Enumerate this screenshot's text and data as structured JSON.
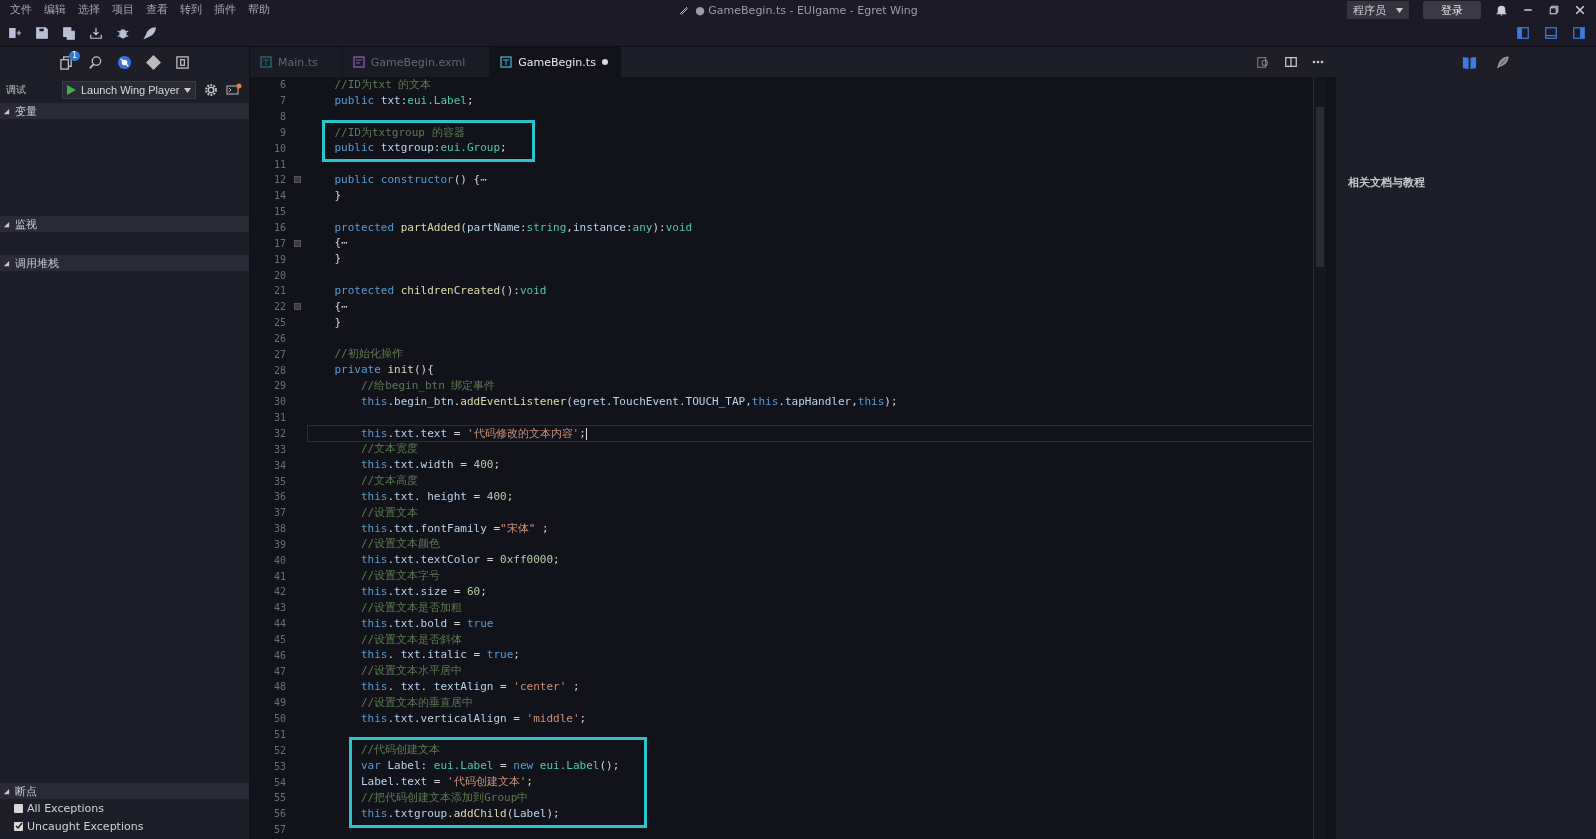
{
  "menu": [
    "文件",
    "编辑",
    "选择",
    "项目",
    "查看",
    "转到",
    "插件",
    "帮助"
  ],
  "window": {
    "title": "● GameBegin.ts - EUIgame - Egret Wing"
  },
  "account": {
    "role": "程序员",
    "login": "登录"
  },
  "activity": {
    "badge": "1"
  },
  "debug": {
    "label": "调试",
    "launch_config": "Launch Wing Player"
  },
  "sections": [
    {
      "title": "变量",
      "expanded": true
    },
    {
      "title": "监视",
      "expanded": true
    },
    {
      "title": "调用堆栈",
      "expanded": true
    }
  ],
  "breakpoints": {
    "title": "断点",
    "expanded": true,
    "items": [
      {
        "label": "All Exceptions",
        "checked": false
      },
      {
        "label": "Uncaught Exceptions",
        "checked": true
      }
    ]
  },
  "tabs": [
    {
      "label": "Main.ts",
      "kind": "ts",
      "selected": false,
      "modified": false
    },
    {
      "label": "GameBegin.exml",
      "kind": "exml",
      "selected": false,
      "modified": false
    },
    {
      "label": "GameBegin.ts",
      "kind": "ts",
      "selected": true,
      "modified": true
    }
  ],
  "editor": {
    "blocks": [
      {
        "boxed": false,
        "lines": [
          {
            "number": "6",
            "folded": false,
            "current": false,
            "tokens": [
              {
                "kind": "comment",
                "text": "    //ID为txt 的文本"
              }
            ]
          },
          {
            "number": "7",
            "folded": false,
            "current": false,
            "tokens": [
              {
                "kind": "keyword",
                "text": "    public "
              },
              {
                "kind": "var",
                "text": "txt"
              },
              {
                "kind": "punct",
                "text": ":"
              },
              {
                "kind": "type",
                "text": "eui.Label"
              },
              {
                "kind": "punct",
                "text": ";"
              }
            ]
          },
          {
            "number": "8",
            "folded": false,
            "current": false
          }
        ]
      },
      {
        "boxed": true,
        "lines": [
          {
            "number": "9",
            "folded": false,
            "current": false,
            "tokens": [
              {
                "kind": "comment",
                "text": "    //ID为txtgroup 的容器"
              }
            ]
          },
          {
            "number": "10",
            "folded": false,
            "current": false,
            "tokens": [
              {
                "kind": "keyword",
                "text": "    public "
              },
              {
                "kind": "var",
                "text": "txtgroup"
              },
              {
                "kind": "punct",
                "text": ":"
              },
              {
                "kind": "type",
                "text": "eui.Group"
              },
              {
                "kind": "punct",
                "text": ";"
              }
            ]
          }
        ]
      },
      {
        "boxed": false,
        "lines": [
          {
            "number": "11",
            "folded": false,
            "current": false
          },
          {
            "number": "12",
            "folded": true,
            "current": false,
            "tokens": [
              {
                "kind": "keyword",
                "text": "    public constructor"
              },
              {
                "kind": "punct",
                "text": "() {⋯"
              }
            ]
          },
          {
            "number": "14",
            "folded": false,
            "current": false,
            "tokens": [
              {
                "kind": "punct",
                "text": "    }"
              }
            ]
          },
          {
            "number": "15",
            "folded": false,
            "current": false
          },
          {
            "number": "16",
            "folded": false,
            "current": false,
            "tokens": [
              {
                "kind": "keyword",
                "text": "    protected "
              },
              {
                "kind": "func",
                "text": "partAdded"
              },
              {
                "kind": "punct",
                "text": "("
              },
              {
                "kind": "var",
                "text": "partName"
              },
              {
                "kind": "punct",
                "text": ":"
              },
              {
                "kind": "type",
                "text": "string"
              },
              {
                "kind": "punct",
                "text": ","
              },
              {
                "kind": "var",
                "text": "instance"
              },
              {
                "kind": "punct",
                "text": ":"
              },
              {
                "kind": "type",
                "text": "any"
              },
              {
                "kind": "punct",
                "text": "):"
              },
              {
                "kind": "type",
                "text": "void"
              }
            ]
          },
          {
            "number": "17",
            "folded": true,
            "current": false,
            "tokens": [
              {
                "kind": "punct",
                "text": "    {⋯"
              }
            ]
          },
          {
            "number": "19",
            "folded": false,
            "current": false,
            "tokens": [
              {
                "kind": "punct",
                "text": "    }"
              }
            ]
          },
          {
            "number": "20",
            "folded": false,
            "current": false
          },
          {
            "number": "21",
            "folded": false,
            "current": false,
            "tokens": [
              {
                "kind": "keyword",
                "text": "    protected "
              },
              {
                "kind": "func",
                "text": "childrenCreated"
              },
              {
                "kind": "punct",
                "text": "():"
              },
              {
                "kind": "type",
                "text": "void"
              }
            ]
          },
          {
            "number": "22",
            "folded": true,
            "current": false,
            "tokens": [
              {
                "kind": "punct",
                "text": "    {⋯"
              }
            ]
          },
          {
            "number": "25",
            "folded": false,
            "current": false,
            "tokens": [
              {
                "kind": "punct",
                "text": "    }"
              }
            ]
          },
          {
            "number": "26",
            "folded": false,
            "current": false
          },
          {
            "number": "27",
            "folded": false,
            "current": false,
            "tokens": [
              {
                "kind": "comment",
                "text": "    //初始化操作"
              }
            ]
          },
          {
            "number": "28",
            "folded": false,
            "current": false,
            "tokens": [
              {
                "kind": "keyword",
                "text": "    private "
              },
              {
                "kind": "func",
                "text": "init"
              },
              {
                "kind": "punct",
                "text": "(){"
              }
            ]
          },
          {
            "number": "29",
            "folded": false,
            "current": false,
            "tokens": [
              {
                "kind": "comment",
                "text": "        //给begin_btn 绑定事件"
              }
            ]
          },
          {
            "number": "30",
            "folded": false,
            "current": false,
            "tokens": [
              {
                "kind": "keyword",
                "text": "        this"
              },
              {
                "kind": "punct",
                "text": "."
              },
              {
                "kind": "var",
                "text": "begin_btn"
              },
              {
                "kind": "punct",
                "text": "."
              },
              {
                "kind": "func",
                "text": "addEventListener"
              },
              {
                "kind": "punct",
                "text": "("
              },
              {
                "kind": "var",
                "text": "egret"
              },
              {
                "kind": "punct",
                "text": "."
              },
              {
                "kind": "var",
                "text": "TouchEvent"
              },
              {
                "kind": "punct",
                "text": "."
              },
              {
                "kind": "var",
                "text": "TOUCH_TAP"
              },
              {
                "kind": "punct",
                "text": ","
              },
              {
                "kind": "keyword",
                "text": "this"
              },
              {
                "kind": "punct",
                "text": "."
              },
              {
                "kind": "var",
                "text": "tapHandler"
              },
              {
                "kind": "punct",
                "text": ","
              },
              {
                "kind": "keyword",
                "text": "this"
              },
              {
                "kind": "punct",
                "text": ");"
              }
            ]
          },
          {
            "number": "31",
            "folded": false,
            "current": false
          },
          {
            "number": "32",
            "folded": false,
            "current": true,
            "tokens": [
              {
                "kind": "keyword",
                "text": "        this"
              },
              {
                "kind": "punct",
                "text": "."
              },
              {
                "kind": "var",
                "text": "txt"
              },
              {
                "kind": "punct",
                "text": "."
              },
              {
                "kind": "var",
                "text": "text"
              },
              {
                "kind": "punct",
                "text": " = "
              },
              {
                "kind": "string",
                "text": "'代码修改的文本内容'"
              },
              {
                "kind": "punct",
                "text": ";"
              }
            ]
          },
          {
            "number": "33",
            "folded": false,
            "current": false,
            "tokens": [
              {
                "kind": "comment",
                "text": "        //文本宽度"
              }
            ]
          },
          {
            "number": "34",
            "folded": false,
            "current": false,
            "tokens": [
              {
                "kind": "keyword",
                "text": "        this"
              },
              {
                "kind": "punct",
                "text": "."
              },
              {
                "kind": "var",
                "text": "txt"
              },
              {
                "kind": "punct",
                "text": "."
              },
              {
                "kind": "var",
                "text": "width"
              },
              {
                "kind": "punct",
                "text": " = "
              },
              {
                "kind": "number",
                "text": "400"
              },
              {
                "kind": "punct",
                "text": ";"
              }
            ]
          },
          {
            "number": "35",
            "folded": false,
            "current": false,
            "tokens": [
              {
                "kind": "comment",
                "text": "        //文本高度"
              }
            ]
          },
          {
            "number": "36",
            "folded": false,
            "current": false,
            "tokens": [
              {
                "kind": "keyword",
                "text": "        this"
              },
              {
                "kind": "punct",
                "text": "."
              },
              {
                "kind": "var",
                "text": "txt"
              },
              {
                "kind": "punct",
                "text": ". "
              },
              {
                "kind": "var",
                "text": "height"
              },
              {
                "kind": "punct",
                "text": " = "
              },
              {
                "kind": "number",
                "text": "400"
              },
              {
                "kind": "punct",
                "text": ";"
              }
            ]
          },
          {
            "number": "37",
            "folded": false,
            "current": false,
            "tokens": [
              {
                "kind": "comment",
                "text": "        //设置文本"
              }
            ]
          },
          {
            "number": "38",
            "folded": false,
            "current": false,
            "tokens": [
              {
                "kind": "keyword",
                "text": "        this"
              },
              {
                "kind": "punct",
                "text": "."
              },
              {
                "kind": "var",
                "text": "txt"
              },
              {
                "kind": "punct",
                "text": "."
              },
              {
                "kind": "var",
                "text": "fontFamily"
              },
              {
                "kind": "punct",
                "text": " ="
              },
              {
                "kind": "string",
                "text": "\"宋体\""
              },
              {
                "kind": "punct",
                "text": " ;"
              }
            ]
          },
          {
            "number": "39",
            "folded": false,
            "current": false,
            "tokens": [
              {
                "kind": "comment",
                "text": "        //设置文本颜色"
              }
            ]
          },
          {
            "number": "40",
            "folded": false,
            "current": false,
            "tokens": [
              {
                "kind": "keyword",
                "text": "        this"
              },
              {
                "kind": "punct",
                "text": "."
              },
              {
                "kind": "var",
                "text": "txt"
              },
              {
                "kind": "punct",
                "text": "."
              },
              {
                "kind": "var",
                "text": "textColor"
              },
              {
                "kind": "punct",
                "text": " = "
              },
              {
                "kind": "number",
                "text": "0xff0000"
              },
              {
                "kind": "punct",
                "text": ";"
              }
            ]
          },
          {
            "number": "41",
            "folded": false,
            "current": false,
            "tokens": [
              {
                "kind": "comment",
                "text": "        //设置文本字号"
              }
            ]
          },
          {
            "number": "42",
            "folded": false,
            "current": false,
            "tokens": [
              {
                "kind": "keyword",
                "text": "        this"
              },
              {
                "kind": "punct",
                "text": "."
              },
              {
                "kind": "var",
                "text": "txt"
              },
              {
                "kind": "punct",
                "text": "."
              },
              {
                "kind": "var",
                "text": "size"
              },
              {
                "kind": "punct",
                "text": " = "
              },
              {
                "kind": "number",
                "text": "60"
              },
              {
                "kind": "punct",
                "text": ";"
              }
            ]
          },
          {
            "number": "43",
            "folded": false,
            "current": false,
            "tokens": [
              {
                "kind": "comment",
                "text": "        //设置文本是否加粗"
              }
            ]
          },
          {
            "number": "44",
            "folded": false,
            "current": false,
            "tokens": [
              {
                "kind": "keyword",
                "text": "        this"
              },
              {
                "kind": "punct",
                "text": "."
              },
              {
                "kind": "var",
                "text": "txt"
              },
              {
                "kind": "punct",
                "text": "."
              },
              {
                "kind": "var",
                "text": "bold"
              },
              {
                "kind": "punct",
                "text": " = "
              },
              {
                "kind": "keyword",
                "text": "true"
              }
            ]
          },
          {
            "number": "45",
            "folded": false,
            "current": false,
            "tokens": [
              {
                "kind": "comment",
                "text": "        //设置文本是否斜体"
              }
            ]
          },
          {
            "number": "46",
            "folded": false,
            "current": false,
            "tokens": [
              {
                "kind": "keyword",
                "text": "        this"
              },
              {
                "kind": "punct",
                "text": ". "
              },
              {
                "kind": "var",
                "text": "txt"
              },
              {
                "kind": "punct",
                "text": "."
              },
              {
                "kind": "var",
                "text": "italic"
              },
              {
                "kind": "punct",
                "text": " = "
              },
              {
                "kind": "keyword",
                "text": "true"
              },
              {
                "kind": "punct",
                "text": ";"
              }
            ]
          },
          {
            "number": "47",
            "folded": false,
            "current": false,
            "tokens": [
              {
                "kind": "comment",
                "text": "        //设置文本水平居中"
              }
            ]
          },
          {
            "number": "48",
            "folded": false,
            "current": false,
            "tokens": [
              {
                "kind": "keyword",
                "text": "        this"
              },
              {
                "kind": "punct",
                "text": ". "
              },
              {
                "kind": "var",
                "text": "txt"
              },
              {
                "kind": "punct",
                "text": ". "
              },
              {
                "kind": "var",
                "text": "textAlign"
              },
              {
                "kind": "punct",
                "text": " = "
              },
              {
                "kind": "string",
                "text": "'center'"
              },
              {
                "kind": "punct",
                "text": " ;"
              }
            ]
          },
          {
            "number": "49",
            "folded": false,
            "current": false,
            "tokens": [
              {
                "kind": "comment",
                "text": "        //设置文本的垂直居中"
              }
            ]
          },
          {
            "number": "50",
            "folded": false,
            "current": false,
            "tokens": [
              {
                "kind": "keyword",
                "text": "        this"
              },
              {
                "kind": "punct",
                "text": "."
              },
              {
                "kind": "var",
                "text": "txt"
              },
              {
                "kind": "punct",
                "text": "."
              },
              {
                "kind": "var",
                "text": "verticalAlign"
              },
              {
                "kind": "punct",
                "text": " = "
              },
              {
                "kind": "string",
                "text": "'middle'"
              },
              {
                "kind": "punct",
                "text": ";"
              }
            ]
          },
          {
            "number": "51",
            "folded": false,
            "current": false
          }
        ]
      },
      {
        "boxed": true,
        "lines": [
          {
            "number": "52",
            "folded": false,
            "current": false,
            "tokens": [
              {
                "kind": "comment",
                "text": "        //代码创建文本"
              }
            ]
          },
          {
            "number": "53",
            "folded": false,
            "current": false,
            "tokens": [
              {
                "kind": "keyword",
                "text": "        var "
              },
              {
                "kind": "var",
                "text": "Label"
              },
              {
                "kind": "punct",
                "text": ": "
              },
              {
                "kind": "type",
                "text": "eui.Label"
              },
              {
                "kind": "punct",
                "text": " = "
              },
              {
                "kind": "keyword",
                "text": "new "
              },
              {
                "kind": "type",
                "text": "eui.Label"
              },
              {
                "kind": "punct",
                "text": "();"
              }
            ]
          },
          {
            "number": "54",
            "folded": false,
            "current": false,
            "tokens": [
              {
                "kind": "var",
                "text": "        Label"
              },
              {
                "kind": "punct",
                "text": "."
              },
              {
                "kind": "var",
                "text": "text"
              },
              {
                "kind": "punct",
                "text": " = "
              },
              {
                "kind": "string",
                "text": "'代码创建文本'"
              },
              {
                "kind": "punct",
                "text": ";"
              }
            ]
          },
          {
            "number": "55",
            "folded": false,
            "current": false,
            "tokens": [
              {
                "kind": "comment",
                "text": "        //把代码创建文本添加到Group中"
              }
            ]
          },
          {
            "number": "56",
            "folded": false,
            "current": false,
            "tokens": [
              {
                "kind": "keyword",
                "text": "        this"
              },
              {
                "kind": "punct",
                "text": "."
              },
              {
                "kind": "var",
                "text": "txtgroup"
              },
              {
                "kind": "punct",
                "text": "."
              },
              {
                "kind": "func",
                "text": "addChild"
              },
              {
                "kind": "punct",
                "text": "("
              },
              {
                "kind": "var",
                "text": "Label"
              },
              {
                "kind": "punct",
                "text": ");"
              }
            ]
          }
        ]
      },
      {
        "boxed": false,
        "lines": [
          {
            "number": "57",
            "folded": false,
            "current": false
          }
        ]
      }
    ]
  },
  "side_panel": {
    "title": "相关文档与教程"
  }
}
